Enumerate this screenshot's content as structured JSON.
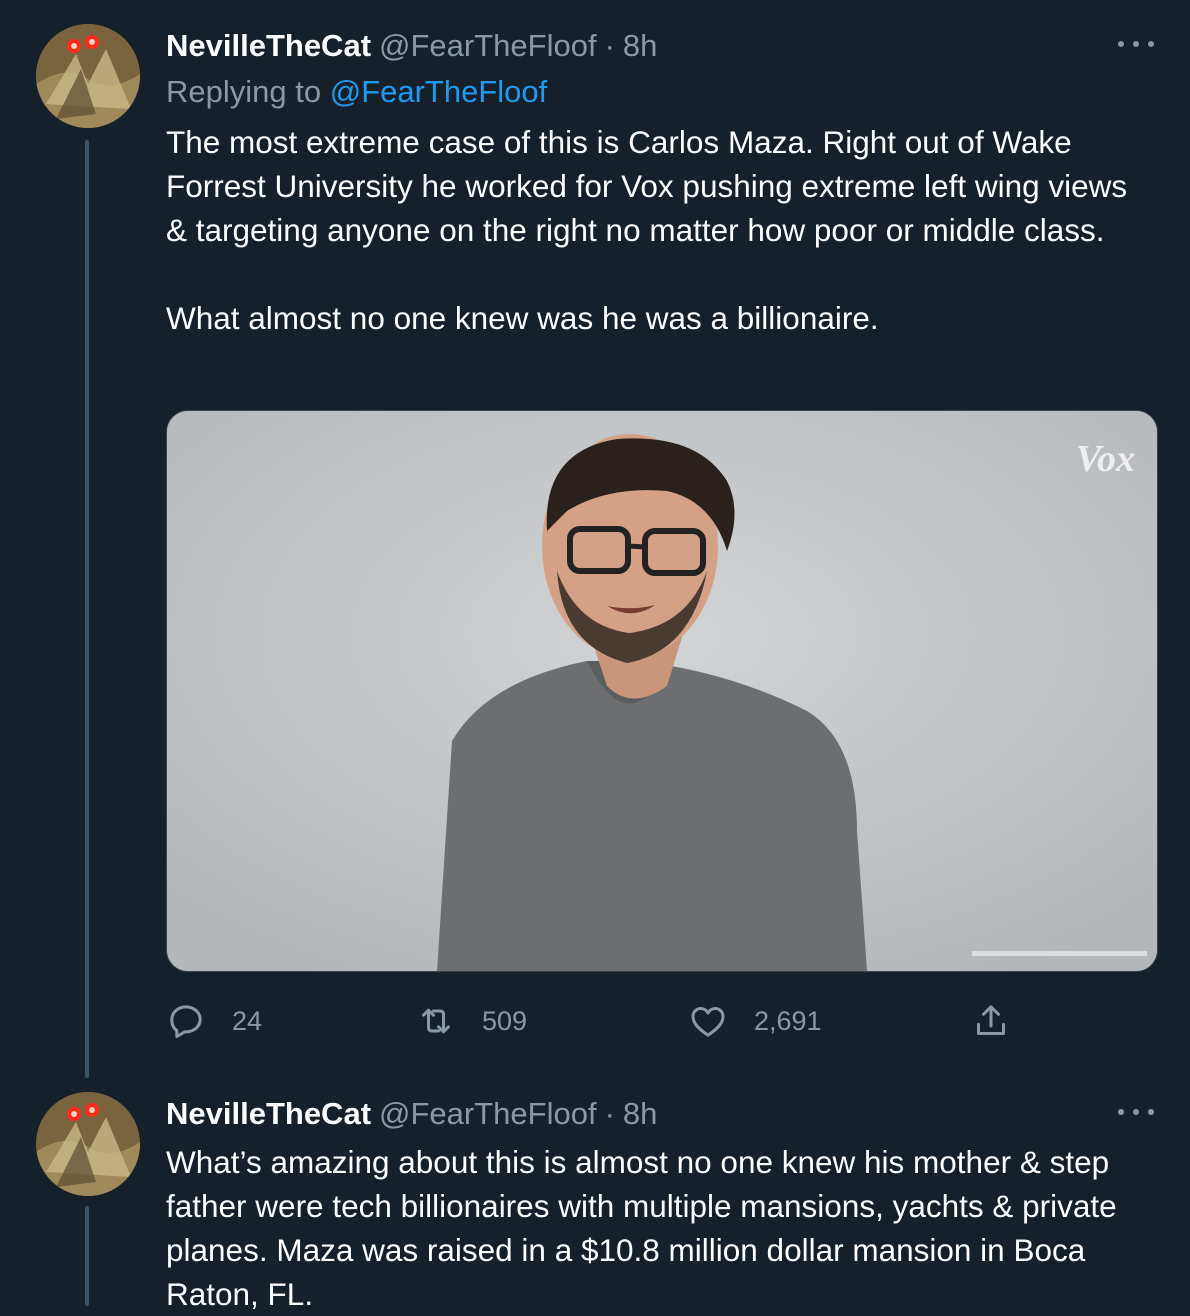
{
  "tweets": [
    {
      "name": "NevilleTheCat",
      "handle": "@FearTheFloof",
      "separator": "·",
      "time": "8h",
      "replying_prefix": "Replying to",
      "replying_to": "@FearTheFloof",
      "text": "The most extreme case of this is Carlos Maza. Right out of Wake Forrest University he worked for Vox pushing extreme left wing views & targeting anyone on the right no matter how poor or middle class.\n\nWhat almost no one knew was he was a billionaire.",
      "media_watermark": "Vox",
      "stats": {
        "replies": "24",
        "retweets": "509",
        "likes": "2,691"
      },
      "icons": {
        "reply": "reply-icon",
        "retweet": "retweet-icon",
        "like": "heart-icon",
        "share": "share-icon",
        "more": "more-icon"
      }
    },
    {
      "name": "NevilleTheCat",
      "handle": "@FearTheFloof",
      "separator": "·",
      "time": "8h",
      "text": "What’s amazing about this is almost no one knew his mother & step father were tech billionaires with multiple mansions, yachts & private planes. Maza was raised in a $10.8 million dollar mansion in Boca Raton, FL."
    }
  ],
  "colors": {
    "background": "#15202b",
    "text": "#ffffff",
    "secondary": "#8b98a5",
    "link": "#1d9bf0",
    "thread_line": "#3d5466"
  }
}
